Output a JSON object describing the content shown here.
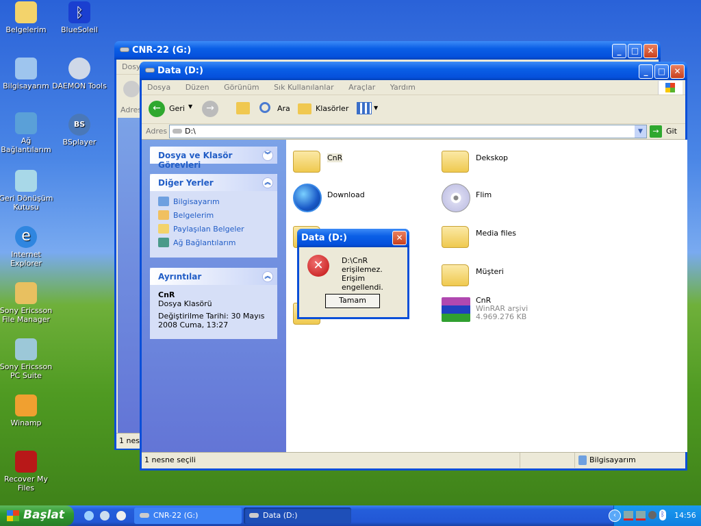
{
  "desktop": {
    "icons": [
      {
        "label": "Belgelerim",
        "icon": "my-documents-icon"
      },
      {
        "label": "BlueSoleil",
        "icon": "bluetooth-icon"
      },
      {
        "label": "Bilgisayarım",
        "icon": "my-computer-icon"
      },
      {
        "label": "DAEMON Tools",
        "icon": "daemon-tools-icon"
      },
      {
        "label": "Ağ Bağlantılarım",
        "icon": "network-icon"
      },
      {
        "label": "BSplayer",
        "icon": "bsplayer-icon"
      },
      {
        "label": "Geri Dönüşüm Kutusu",
        "icon": "recycle-bin-icon"
      },
      {
        "label": "Internet Explorer",
        "icon": "ie-icon"
      },
      {
        "label": "Sony Ericsson File Manager",
        "icon": "file-manager-icon"
      },
      {
        "label": "Sony Ericsson PC Suite",
        "icon": "pc-suite-icon"
      },
      {
        "label": "Winamp",
        "icon": "winamp-icon"
      },
      {
        "label": "Recover My Files",
        "icon": "recover-icon"
      }
    ]
  },
  "back_window": {
    "title": "CNR-22 (G:)",
    "menu_first": "Dosya",
    "address_label": "Adres",
    "status": "1 nesne"
  },
  "window": {
    "title": "Data (D:)",
    "menu": [
      "Dosya",
      "Düzen",
      "Görünüm",
      "Sık Kullanılanlar",
      "Araçlar",
      "Yardım"
    ],
    "toolbar": {
      "back": "Geri",
      "search": "Ara",
      "folders": "Klasörler"
    },
    "address": {
      "label": "Adres",
      "value": "D:\\",
      "go": "Git"
    },
    "tasks": {
      "title": "Dosya ve Klasör Görevleri"
    },
    "other_places": {
      "title": "Diğer Yerler",
      "links": [
        "Bilgisayarım",
        "Belgelerim",
        "Paylaşılan Belgeler",
        "Ağ Bağlantılarım"
      ]
    },
    "details": {
      "title": "Ayrıntılar",
      "name": "CnR",
      "type": "Dosya Klasörü",
      "modified": "Değiştirilme Tarihi: 30 Mayıs 2008 Cuma, 13:27"
    },
    "items": [
      {
        "name": "CnR",
        "icon": "folder"
      },
      {
        "name": "Dekskop",
        "icon": "folder"
      },
      {
        "name": "Download",
        "icon": "ie-globe"
      },
      {
        "name": "Flim",
        "icon": "dvd"
      },
      {
        "name": "Media files",
        "icon": "folder"
      },
      {
        "name": "Müşteri",
        "icon": "folder"
      },
      {
        "name": "CnR",
        "icon": "winrar",
        "type": "WinRAR arşivi",
        "size": "4.969.276 KB"
      }
    ],
    "status": {
      "left": "1 nesne seçili",
      "right": "Bilgisayarım"
    }
  },
  "dialog": {
    "title": "Data (D:)",
    "line1": "D:\\CnR erişilemez.",
    "line2": "Erişim engellendi.",
    "ok": "Tamam"
  },
  "taskbar": {
    "start": "Başlat",
    "tasks": [
      "CNR-22 (G:)",
      "Data (D:)"
    ],
    "clock": "14:56"
  }
}
